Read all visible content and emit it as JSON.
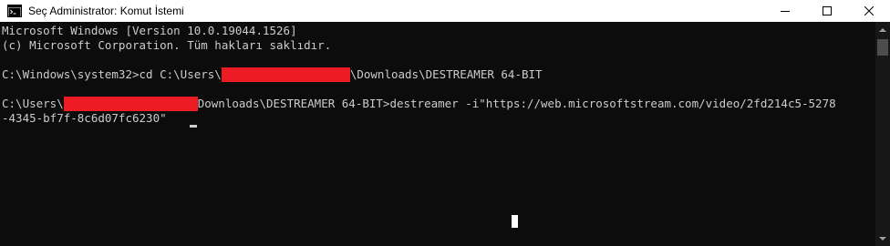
{
  "window": {
    "title": "Seç Administrator: Komut İstemi",
    "icon": "cmd-icon",
    "controls": [
      "minimize-icon",
      "maximize-icon",
      "close-icon"
    ]
  },
  "console": {
    "header_line1": "Microsoft Windows [Version 10.0.19044.1526]",
    "header_line2": "(c) Microsoft Corporation. Tüm hakları saklıdır.",
    "cmd1": {
      "before": "C:\\Windows\\system32>cd C:\\Users\\",
      "after": "\\Downloads\\DESTREAMER 64-BIT"
    },
    "cmd2": {
      "before": "C:\\Users\\",
      "after": "Downloads\\DESTREAMER 64-BIT>destreamer -i\"https://web.microsoftstream.com/video/2fd214c5-5278",
      "wrap": "-4345-bf7f-8c6d07fc6230\""
    }
  },
  "colors": {
    "terminal_bg": "#0c0c0c",
    "terminal_text": "#cccccc",
    "redaction": "#ed1c24",
    "titlebar_bg": "#ffffff"
  }
}
